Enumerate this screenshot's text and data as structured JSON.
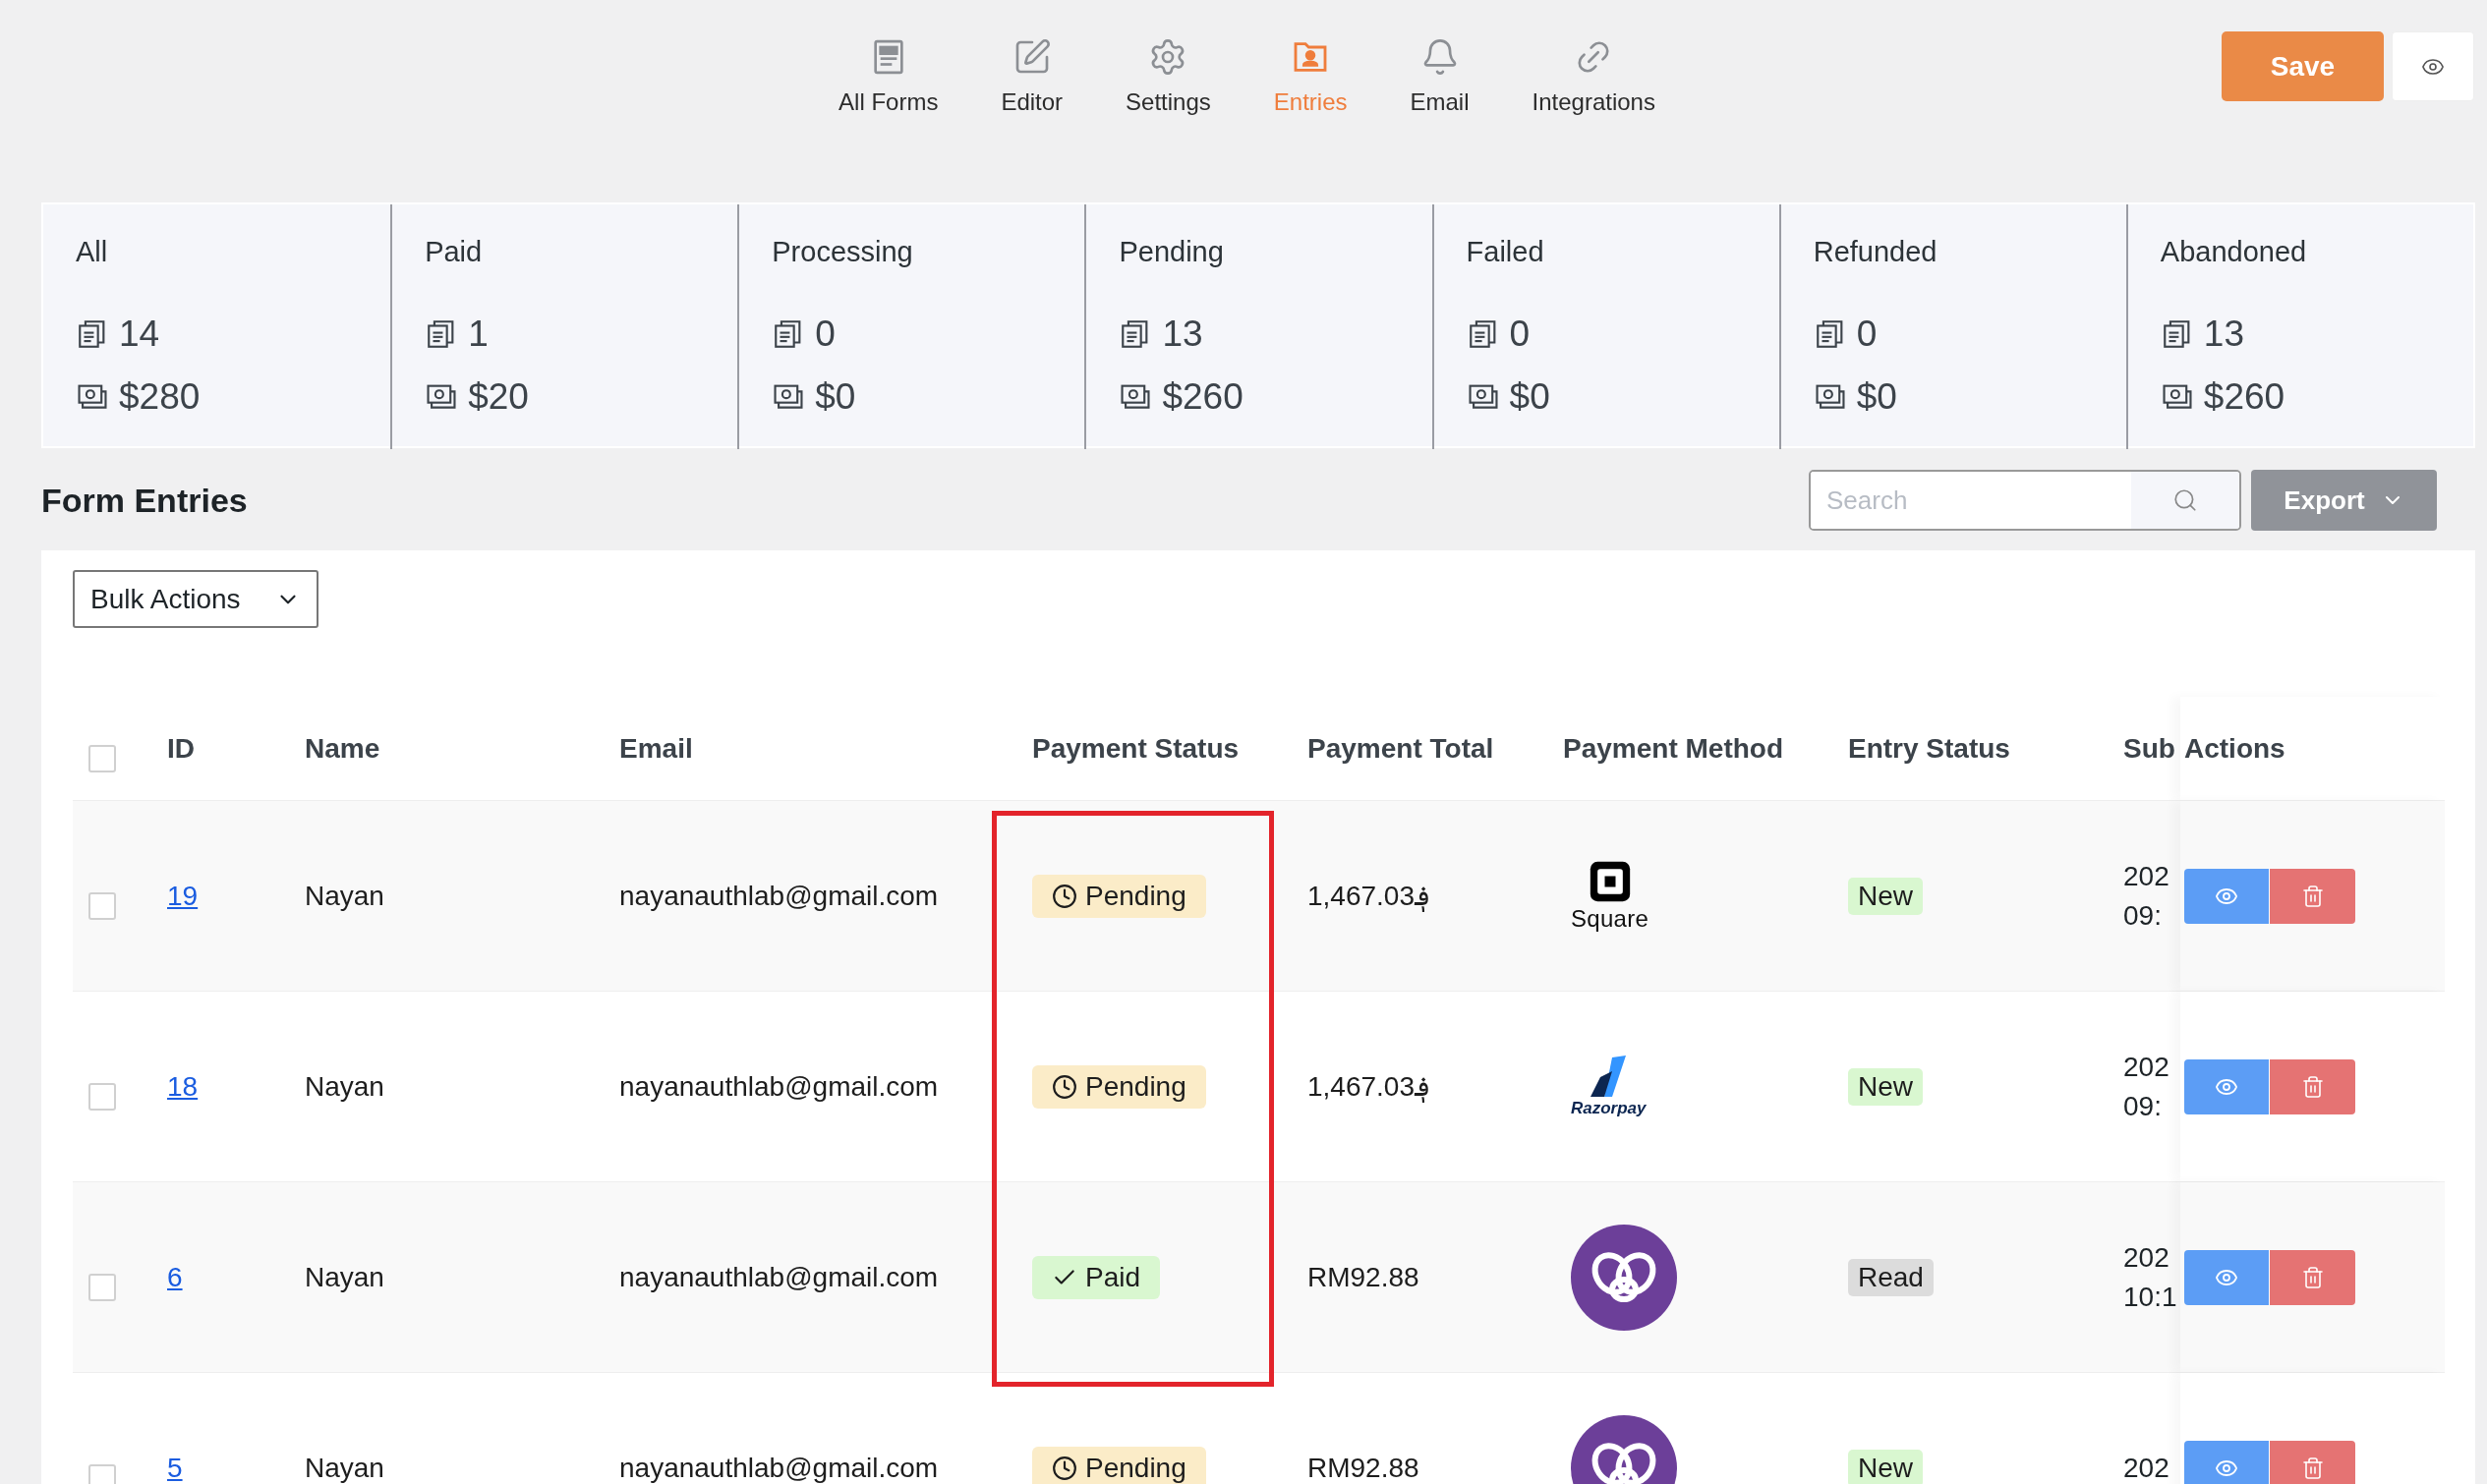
{
  "nav": {
    "items": [
      {
        "label": "All Forms",
        "kind": "forms",
        "selected": false
      },
      {
        "label": "Editor",
        "kind": "editor",
        "selected": false
      },
      {
        "label": "Settings",
        "kind": "settings",
        "selected": false
      },
      {
        "label": "Entries",
        "kind": "entries",
        "selected": true
      },
      {
        "label": "Email",
        "kind": "email",
        "selected": false
      },
      {
        "label": "Integrations",
        "kind": "integrations",
        "selected": false
      }
    ]
  },
  "save_button": "Save",
  "stats": [
    {
      "label": "All",
      "count": "14",
      "amount": "$280"
    },
    {
      "label": "Paid",
      "count": "1",
      "amount": "$20"
    },
    {
      "label": "Processing",
      "count": "0",
      "amount": "$0"
    },
    {
      "label": "Pending",
      "count": "13",
      "amount": "$260"
    },
    {
      "label": "Failed",
      "count": "0",
      "amount": "$0"
    },
    {
      "label": "Refunded",
      "count": "0",
      "amount": "$0"
    },
    {
      "label": "Abandoned",
      "count": "13",
      "amount": "$260"
    }
  ],
  "entries": {
    "title": "Form Entries",
    "search": {
      "placeholder": "Search"
    },
    "export_button": "Export",
    "bulk_actions": "Bulk Actions",
    "header_checkbox": {
      "checked": false
    },
    "columns": [
      "ID",
      "Name",
      "Email",
      "Payment Status",
      "Payment Total",
      "Payment Method",
      "Entry Status",
      "Sub",
      "Actions"
    ],
    "rows": [
      {
        "checked": false,
        "id": "19",
        "name": "Nayan",
        "email": "nayanauthlab@gmail.com",
        "payment_status": {
          "kind": "pending",
          "label": "Pending"
        },
        "payment_total": "1,467.03؋",
        "payment_method": {
          "kind": "square",
          "label": "Square"
        },
        "entry_status": {
          "kind": "new",
          "label": "New"
        },
        "submitted": [
          "202",
          "09:"
        ],
        "highlighted": true
      },
      {
        "checked": false,
        "id": "18",
        "name": "Nayan",
        "email": "nayanauthlab@gmail.com",
        "payment_status": {
          "kind": "pending",
          "label": "Pending"
        },
        "payment_total": "1,467.03؋",
        "payment_method": {
          "kind": "razorpay",
          "label": "Razorpay"
        },
        "entry_status": {
          "kind": "new",
          "label": "New"
        },
        "submitted": [
          "202",
          "09:"
        ],
        "highlighted": true
      },
      {
        "checked": false,
        "id": "6",
        "name": "Nayan",
        "email": "nayanauthlab@gmail.com",
        "payment_status": {
          "kind": "paid",
          "label": "Paid"
        },
        "payment_total": "RM92.88",
        "payment_method": {
          "kind": "circle"
        },
        "entry_status": {
          "kind": "read",
          "label": "Read"
        },
        "submitted": [
          "202",
          "10:1"
        ],
        "highlighted": true
      },
      {
        "checked": false,
        "id": "5",
        "name": "Nayan",
        "email": "nayanauthlab@gmail.com",
        "payment_status": {
          "kind": "pending",
          "label": "Pending"
        },
        "payment_total": "RM92.88",
        "payment_method": {
          "kind": "circle"
        },
        "entry_status": {
          "kind": "new",
          "label": "New"
        },
        "submitted": [
          "202"
        ],
        "highlighted": false
      }
    ]
  }
}
